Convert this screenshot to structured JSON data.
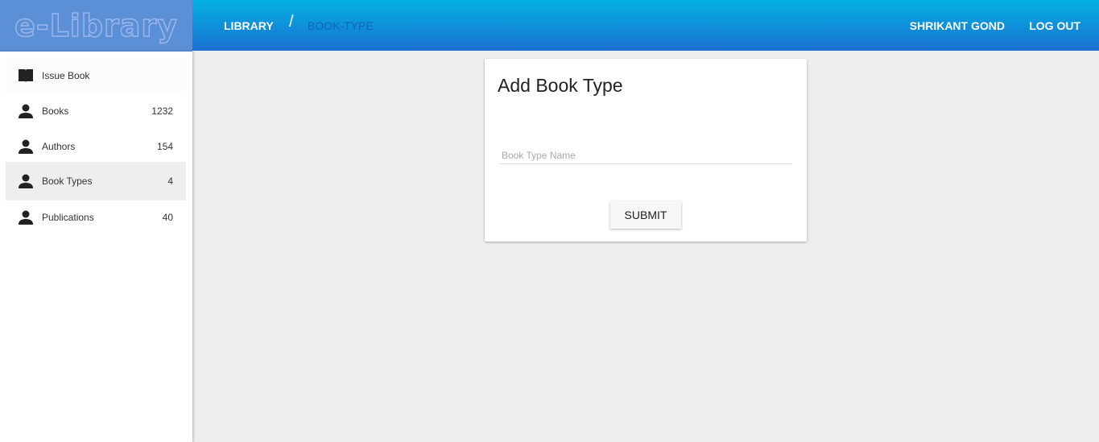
{
  "logo": "e-Library",
  "header": {
    "breadcrumb": [
      "LIBRARY",
      "/",
      "BOOK-TYPE"
    ],
    "user": "SHRIKANT GOND",
    "logout": "LOG OUT"
  },
  "sidebar": {
    "items": [
      {
        "label": "Issue Book",
        "count": "",
        "icon": "book-open-icon"
      },
      {
        "label": "Books",
        "count": "1232",
        "icon": "person-icon"
      },
      {
        "label": "Authors",
        "count": "154",
        "icon": "person-icon"
      },
      {
        "label": "Book Types",
        "count": "4",
        "icon": "person-icon"
      },
      {
        "label": "Publications",
        "count": "40",
        "icon": "person-icon"
      }
    ]
  },
  "form": {
    "title": "Add Book Type",
    "placeholder": "Book Type Name",
    "value": "",
    "submit": "SUBMIT"
  }
}
